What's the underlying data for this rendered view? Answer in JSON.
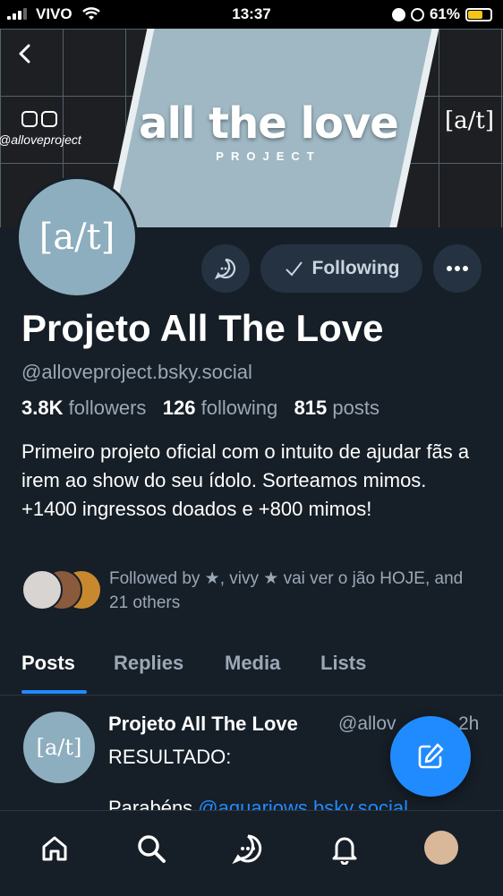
{
  "status_bar": {
    "carrier": "VIVO",
    "time": "13:37",
    "battery": "61%"
  },
  "banner": {
    "title": "all the love",
    "subtitle": "PROJECT",
    "handle": "@alloveproject",
    "logo_text": "[a/t]"
  },
  "profile": {
    "display_name": "Projeto All The Love",
    "handle": "@alloveproject.bsky.social",
    "followers_count": "3.8K",
    "followers_label": "followers",
    "following_count": "126",
    "following_label": "following",
    "posts_count": "815",
    "posts_label": "posts",
    "bio": "Primeiro projeto oficial com o intuito de ajudar fãs a irem ao show do seu ídolo. Sorteamos mimos. +1400 ingressos doados e +800 mimos!",
    "followed_by": "Followed by ★, vivy ★ vai ver o jão HOJE, and 21 others",
    "avatar_text": "[a/t]"
  },
  "actions": {
    "following_label": "Following"
  },
  "tabs": [
    {
      "label": "Posts",
      "active": true
    },
    {
      "label": "Replies",
      "active": false
    },
    {
      "label": "Media",
      "active": false
    },
    {
      "label": "Lists",
      "active": false
    }
  ],
  "post": {
    "author": "Projeto All The Love",
    "handle": "@allov",
    "time": "2h",
    "line1": "RESULTADO:",
    "line2_prefix": "Parabéns ",
    "line2_mention": "@aquariows.bsky.social"
  },
  "colors": {
    "background": "#161e27",
    "accent": "#208bfe",
    "secondary_text": "#9aa8b6"
  },
  "icons": [
    "back-arrow-icon",
    "chat-icon",
    "check-icon",
    "more-icon",
    "compose-icon",
    "home-icon",
    "search-icon",
    "chat-icon",
    "bell-icon",
    "profile-avatar"
  ]
}
